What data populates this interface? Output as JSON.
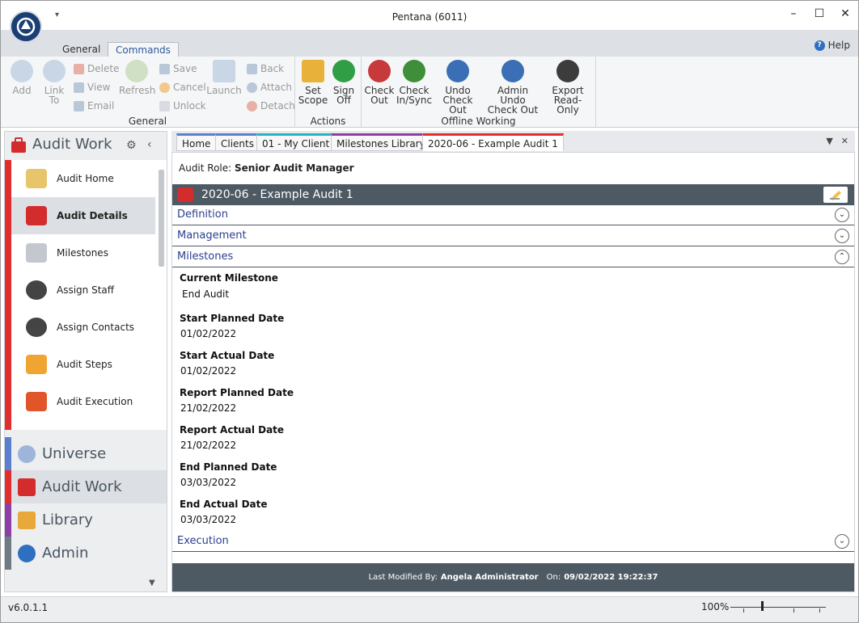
{
  "window": {
    "title": "Pentana (6011)",
    "qat_label": "▾",
    "controls": {
      "minimize": "–",
      "maximize": "☐",
      "close": "✕"
    }
  },
  "ribbon": {
    "tabs": [
      {
        "label": "General",
        "active": false
      },
      {
        "label": "Commands",
        "active": true
      }
    ],
    "help_label": "Help",
    "groups": {
      "general": {
        "label": "General",
        "add": "Add",
        "link_to": "Link To",
        "delete": "Delete",
        "view": "View",
        "email": "Email",
        "refresh": "Refresh",
        "save": "Save",
        "cancel": "Cancel",
        "unlock": "Unlock",
        "launch": "Launch",
        "back": "Back",
        "attach": "Attach",
        "detach": "Detach"
      },
      "actions": {
        "label": "Actions",
        "set_scope": "Set Scope",
        "sign_off": "Sign Off"
      },
      "offline": {
        "label": "Offline Working",
        "check_out": "Check Out",
        "check_in_sync": "Check In/Sync",
        "undo_check_out": "Undo Check Out",
        "admin_undo_check_out": "Admin Undo Check Out",
        "export_read_only": "Export Read-Only"
      }
    }
  },
  "nav": {
    "header": "Audit Work",
    "items": [
      {
        "label": "Audit Home",
        "active": false
      },
      {
        "label": "Audit Details",
        "active": true
      },
      {
        "label": "Milestones",
        "active": false
      },
      {
        "label": "Assign Staff",
        "active": false
      },
      {
        "label": "Assign Contacts",
        "active": false
      },
      {
        "label": "Audit Steps",
        "active": false
      },
      {
        "label": "Audit Execution",
        "active": false
      }
    ],
    "sections": [
      {
        "label": "Universe",
        "color": "#5b7fcf"
      },
      {
        "label": "Audit Work",
        "color": "#e02d2d"
      },
      {
        "label": "Library",
        "color": "#8e3fa5"
      },
      {
        "label": "Admin",
        "color": "#6e7b85"
      }
    ]
  },
  "doc_tabs": [
    {
      "label": "Home",
      "color": "#5b7fcf",
      "active": false
    },
    {
      "label": "Clients",
      "color": "#5b7fcf",
      "active": false
    },
    {
      "label": "01 - My Client",
      "color": "#25b3c4",
      "active": false
    },
    {
      "label": "Milestones Library",
      "color": "#8e3fa5",
      "active": false
    },
    {
      "label": "2020-06 - Example Audit 1",
      "color": "#e02d2d",
      "active": true
    }
  ],
  "content": {
    "role_label": "Audit Role:",
    "role_value": "Senior Audit Manager",
    "audit_title": "2020-06 - Example Audit 1",
    "sections": {
      "definition": "Definition",
      "management": "Management",
      "milestones": "Milestones",
      "execution": "Execution"
    },
    "milestones": {
      "current_label": "Current Milestone",
      "current_value": "End Audit",
      "start_planned_label": "Start Planned Date",
      "start_planned_value": "01/02/2022",
      "start_actual_label": "Start Actual Date",
      "start_actual_value": "01/02/2022",
      "report_planned_label": "Report Planned Date",
      "report_planned_value": "21/02/2022",
      "report_actual_label": "Report Actual Date",
      "report_actual_value": "21/02/2022",
      "end_planned_label": "End Planned Date",
      "end_planned_value": "03/03/2022",
      "end_actual_label": "End Actual Date",
      "end_actual_value": "03/03/2022"
    },
    "footer": {
      "modified_label": "Last Modified By:",
      "modified_by": "Angela Administrator",
      "on_label": "On:",
      "modified_on": "09/02/2022 19:22:37"
    }
  },
  "status": {
    "version": "v6.0.1.1",
    "zoom": "100%",
    "zoom_fraction": 0.33
  },
  "colors": {
    "accent_red": "#e02d2d",
    "header_dark": "#4e5a63",
    "link_blue": "#2a3f8e"
  }
}
